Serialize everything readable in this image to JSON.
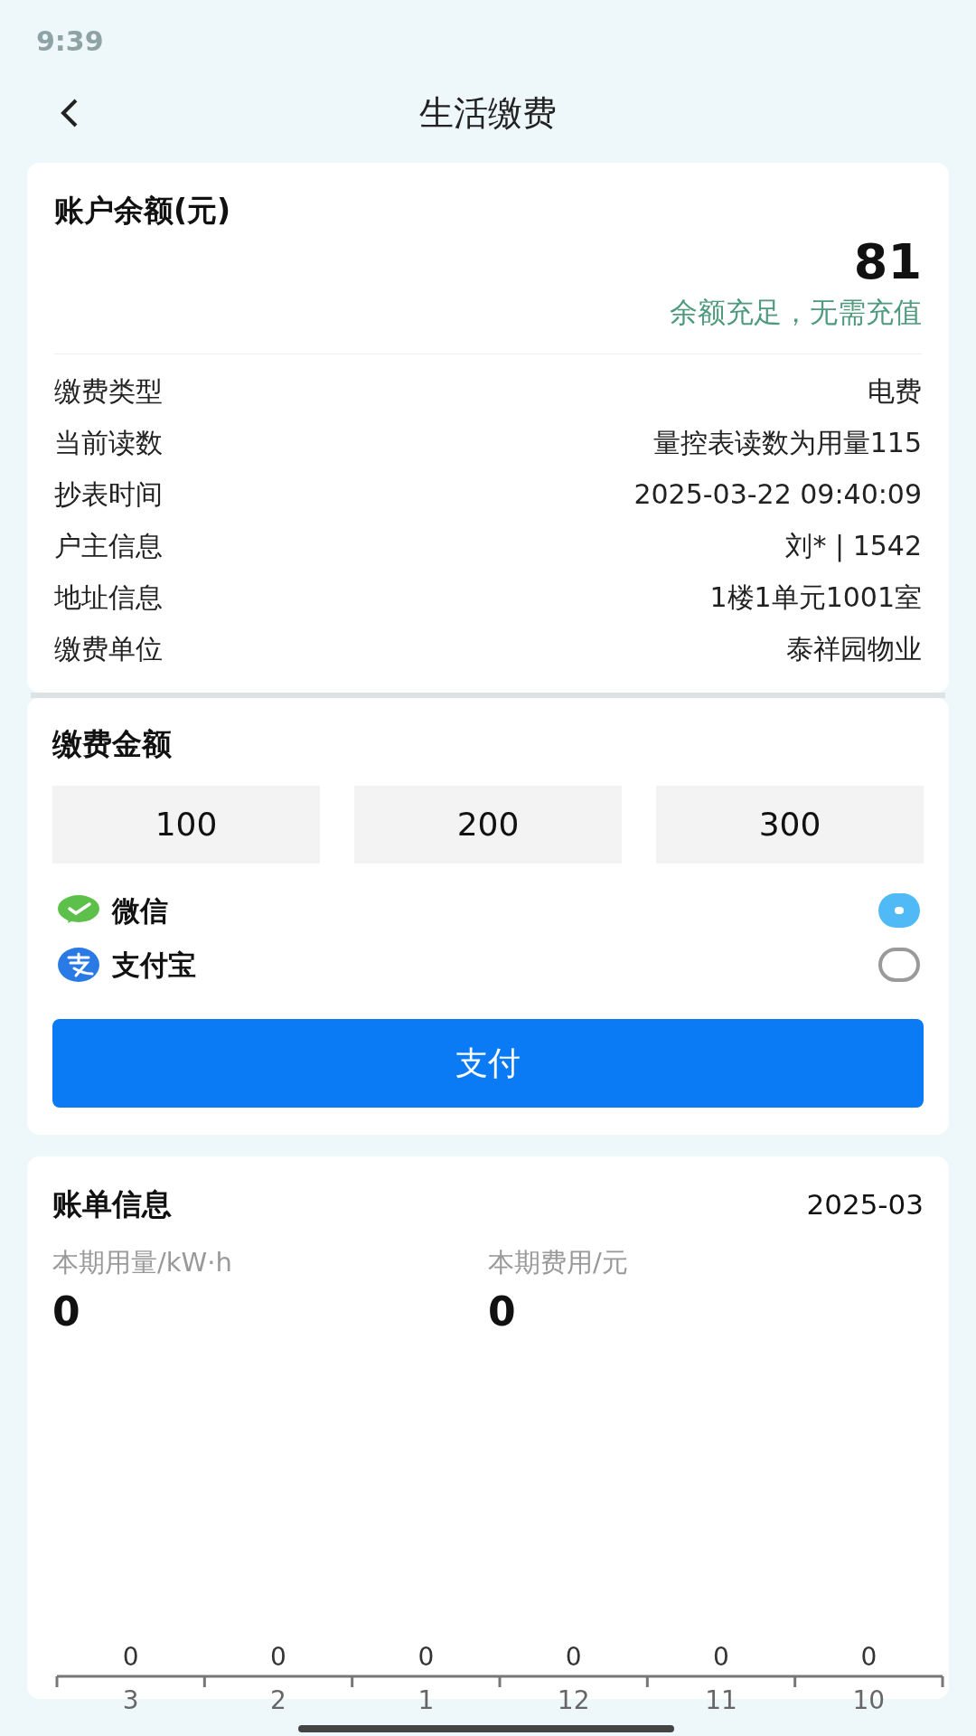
{
  "status_bar": {
    "time": "9:39"
  },
  "header": {
    "title": "生活缴费"
  },
  "balance": {
    "label": "账户余额(元)",
    "amount": "81",
    "note": "余额充足，无需充值"
  },
  "details": [
    {
      "label": "缴费类型",
      "value": "电费"
    },
    {
      "label": "当前读数",
      "value": "量控表读数为用量115"
    },
    {
      "label": "抄表时间",
      "value": "2025-03-22 09:40:09"
    },
    {
      "label": "户主信息",
      "value": "刘* | 1542"
    },
    {
      "label": "地址信息",
      "value": "1楼1单元1001室"
    },
    {
      "label": "缴费单位",
      "value": "泰祥园物业"
    }
  ],
  "payment": {
    "title": "缴费金额",
    "amounts": [
      "100",
      "200",
      "300"
    ],
    "methods": [
      {
        "kind": "wechat",
        "label": "微信",
        "selected": true
      },
      {
        "kind": "alipay",
        "label": "支付宝",
        "selected": false
      }
    ],
    "pay_button": "支付"
  },
  "bill": {
    "title": "账单信息",
    "month": "2025-03",
    "stats": [
      {
        "label": "本期用量/kW·h",
        "value": "0"
      },
      {
        "label": "本期费用/元",
        "value": "0"
      }
    ],
    "chart": {
      "value_labels": [
        "0",
        "0",
        "0",
        "0",
        "0",
        "0"
      ],
      "month_labels": [
        "3",
        "2",
        "1",
        "12",
        "11",
        "10"
      ]
    }
  }
}
